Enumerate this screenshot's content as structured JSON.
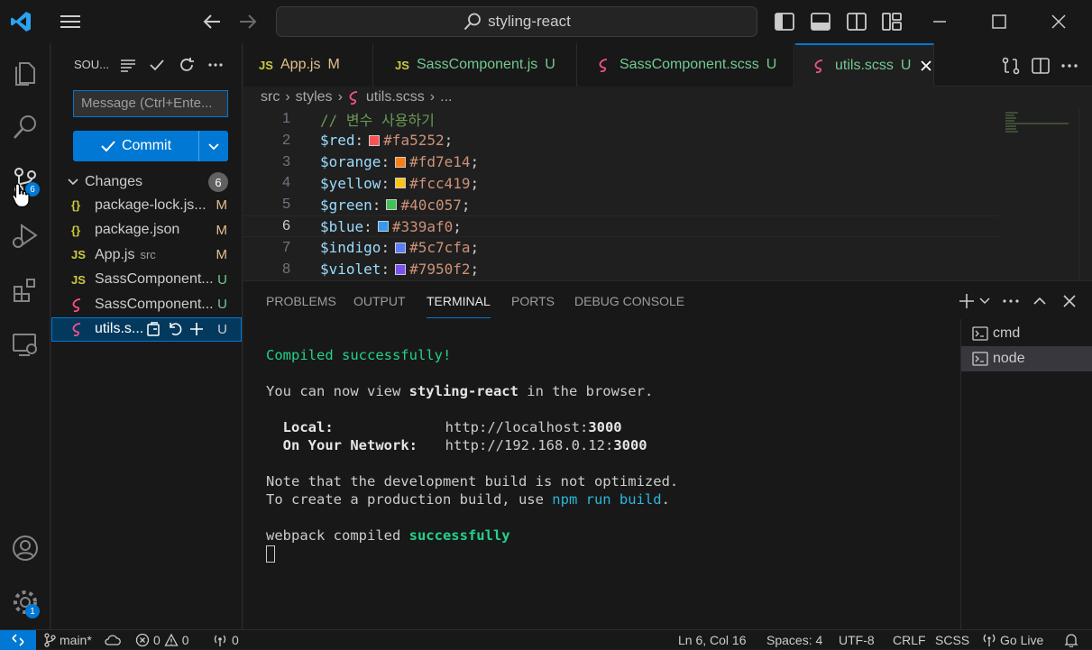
{
  "window": {
    "search_text": "styling-react"
  },
  "activity_bar": {
    "scm_badge": "6",
    "settings_badge": "1"
  },
  "sidebar": {
    "title": "SOU...",
    "commit_placeholder": "Message (Ctrl+Ente...",
    "commit_label": "Commit",
    "changes_label": "Changes",
    "changes_count": "6",
    "files": [
      {
        "icon": "{}",
        "name": "package-lock.js...",
        "hint": "",
        "status": "M",
        "icon_color": "#cbcb41",
        "status_color": "#e2c08d"
      },
      {
        "icon": "{}",
        "name": "package.json",
        "hint": "",
        "status": "M",
        "icon_color": "#cbcb41",
        "status_color": "#e2c08d"
      },
      {
        "icon": "JS",
        "name": "App.js",
        "hint": "src",
        "status": "M",
        "icon_color": "#cbcb41",
        "status_color": "#e2c08d"
      },
      {
        "icon": "JS",
        "name": "SassComponent...",
        "hint": "",
        "status": "U",
        "icon_color": "#cbcb41",
        "status_color": "#73c991"
      },
      {
        "icon": "sass",
        "name": "SassComponent...",
        "hint": "",
        "status": "U",
        "icon_color": "#f55385",
        "status_color": "#73c991"
      },
      {
        "icon": "sass",
        "name": "utils.s...",
        "hint": "",
        "status": "U",
        "icon_color": "#f55385",
        "status_color": "#cccccc"
      }
    ]
  },
  "tabs": [
    {
      "icon": "JS",
      "label": "App.js",
      "status": "M",
      "label_color": "#e2c08d",
      "icon_color": "#cbcb41"
    },
    {
      "icon": "JS",
      "label": "SassComponent.js",
      "status": "U",
      "label_color": "#73c991",
      "icon_color": "#cbcb41"
    },
    {
      "icon": "sass",
      "label": "SassComponent.scss",
      "status": "U",
      "label_color": "#73c991",
      "icon_color": "#f55385"
    },
    {
      "icon": "sass",
      "label": "utils.scss",
      "status": "U",
      "label_color": "#73c991",
      "icon_color": "#f55385"
    }
  ],
  "breadcrumb": {
    "parts": [
      "src",
      "styles",
      "utils.scss",
      "..."
    ]
  },
  "code": [
    {
      "n": "1",
      "comment": "// 변수 사용하기"
    },
    {
      "n": "2",
      "var": "$red",
      "color": "#fa5252"
    },
    {
      "n": "3",
      "var": "$orange",
      "color": "#fd7e14"
    },
    {
      "n": "4",
      "var": "$yellow",
      "color": "#fcc419"
    },
    {
      "n": "5",
      "var": "$green",
      "color": "#40c057"
    },
    {
      "n": "6",
      "var": "$blue",
      "color": "#339af0"
    },
    {
      "n": "7",
      "var": "$indigo",
      "color": "#5c7cfa"
    },
    {
      "n": "8",
      "var": "$violet",
      "color": "#7950f2"
    }
  ],
  "panel": {
    "tabs": [
      "PROBLEMS",
      "OUTPUT",
      "TERMINAL",
      "PORTS",
      "DEBUG CONSOLE"
    ],
    "active_tab": "TERMINAL",
    "terminals": [
      "cmd",
      "node"
    ]
  },
  "terminal": {
    "compiled": "Compiled successfully!",
    "view_1": "You can now view ",
    "view_app": "styling-react",
    "view_2": " in the browser.",
    "local_label": "Local:",
    "local_url": "http://localhost:",
    "local_port": "3000",
    "net_label": "On Your Network:",
    "net_url": "http://192.168.0.12:",
    "net_port": "3000",
    "note_1": "Note that the development build is not optimized.",
    "note_2a": "To create a production build, use ",
    "note_2b": "npm run build",
    "note_2c": ".",
    "webpack_a": "webpack compiled ",
    "webpack_b": "successfully"
  },
  "status_bar": {
    "branch": "main*",
    "errors": "0",
    "warnings": "0",
    "ports": "0",
    "position": "Ln 6, Col 16",
    "spaces": "Spaces: 4",
    "encoding": "UTF-8",
    "eol": "CRLF",
    "language": "SCSS",
    "golive": "Go Live"
  }
}
